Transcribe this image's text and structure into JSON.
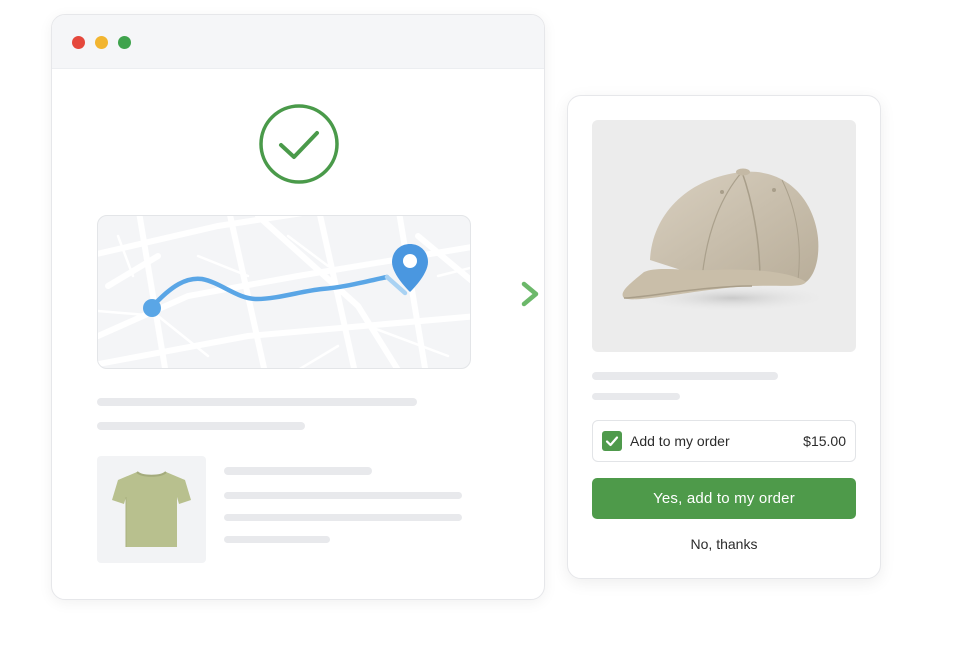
{
  "browser_window": {
    "controls": [
      "close-dot",
      "minimize-dot",
      "zoom-dot"
    ]
  },
  "confirmation": {
    "icon": "check-circle-icon",
    "color": "#4a9a4a"
  },
  "map": {
    "route_color": "#5aa6e6",
    "pin_color": "#4a97e0",
    "icon": "location-pin-icon"
  },
  "product": {
    "image": "green-tshirt",
    "color": "#b8c08e"
  },
  "transition": {
    "icon": "arrow-right-icon",
    "color": "#7cc07a"
  },
  "upsell": {
    "image": "baseball-cap",
    "addon_label": "Add to my order",
    "addon_price": "$15.00",
    "addon_checked": true,
    "accept_label": "Yes, add to my order",
    "decline_label": "No, thanks",
    "accent_color": "#4e9a4a"
  }
}
